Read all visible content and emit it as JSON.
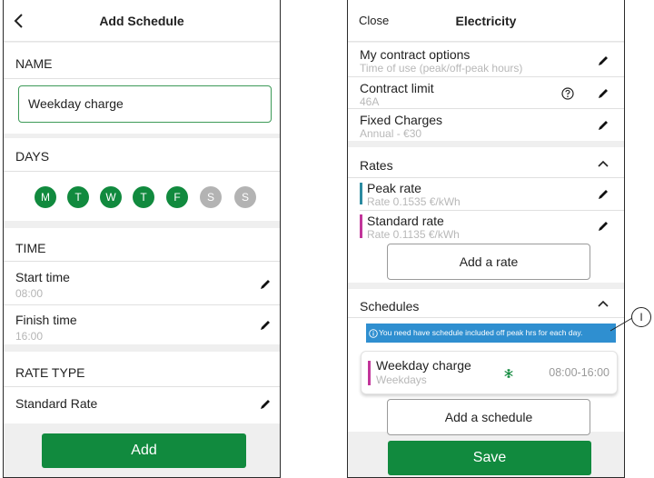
{
  "left_screen": {
    "title": "Add Schedule",
    "name_section": {
      "label": "NAME",
      "value": "Weekday charge"
    },
    "days_section": {
      "label": "DAYS",
      "days": [
        {
          "letter": "M",
          "selected": true
        },
        {
          "letter": "T",
          "selected": true
        },
        {
          "letter": "W",
          "selected": true
        },
        {
          "letter": "T",
          "selected": true
        },
        {
          "letter": "F",
          "selected": true
        },
        {
          "letter": "S",
          "selected": false
        },
        {
          "letter": "S",
          "selected": false
        }
      ]
    },
    "time_section": {
      "label": "TIME",
      "start_label": "Start time",
      "start_value": "08:00",
      "finish_label": "Finish time",
      "finish_value": "16:00"
    },
    "rate_type_section": {
      "label": "RATE TYPE",
      "value": "Standard Rate"
    },
    "add_button": "Add"
  },
  "right_screen": {
    "close_label": "Close",
    "title": "Electricity",
    "contract_options": {
      "label": "My contract options",
      "value": "Time of use (peak/off-peak hours)"
    },
    "contract_limit": {
      "label": "Contract limit",
      "value": "46A"
    },
    "fixed_charges": {
      "label": "Fixed Charges",
      "value": "Annual - €30"
    },
    "rates": {
      "label": "Rates",
      "items": [
        {
          "name": "Peak rate",
          "detail": "Rate 0.1535 €/kWh",
          "color": "#2b8aa0"
        },
        {
          "name": "Standard rate",
          "detail": "Rate 0.1135 €/kWh",
          "color": "#c2359a"
        }
      ],
      "add_label": "Add a rate"
    },
    "schedules": {
      "label": "Schedules",
      "info_banner": "You need have schedule included off peak hrs for each day.",
      "card": {
        "name": "Weekday charge",
        "days": "Weekdays",
        "time": "08:00-16:00"
      },
      "add_label": "Add a schedule"
    },
    "save_button": "Save"
  },
  "callout": {
    "label": "I"
  },
  "colors": {
    "primary_green": "#118a3e",
    "day_off_gray": "#b3b3b3",
    "info_blue": "#2f8fd0",
    "peak_rate_teal": "#2b8aa0",
    "standard_rate_magenta": "#c2359a"
  },
  "icons": [
    "chevron-left-icon",
    "pencil-icon",
    "help-circle-icon",
    "chevron-up-icon",
    "info-icon",
    "snowflake-icon"
  ]
}
